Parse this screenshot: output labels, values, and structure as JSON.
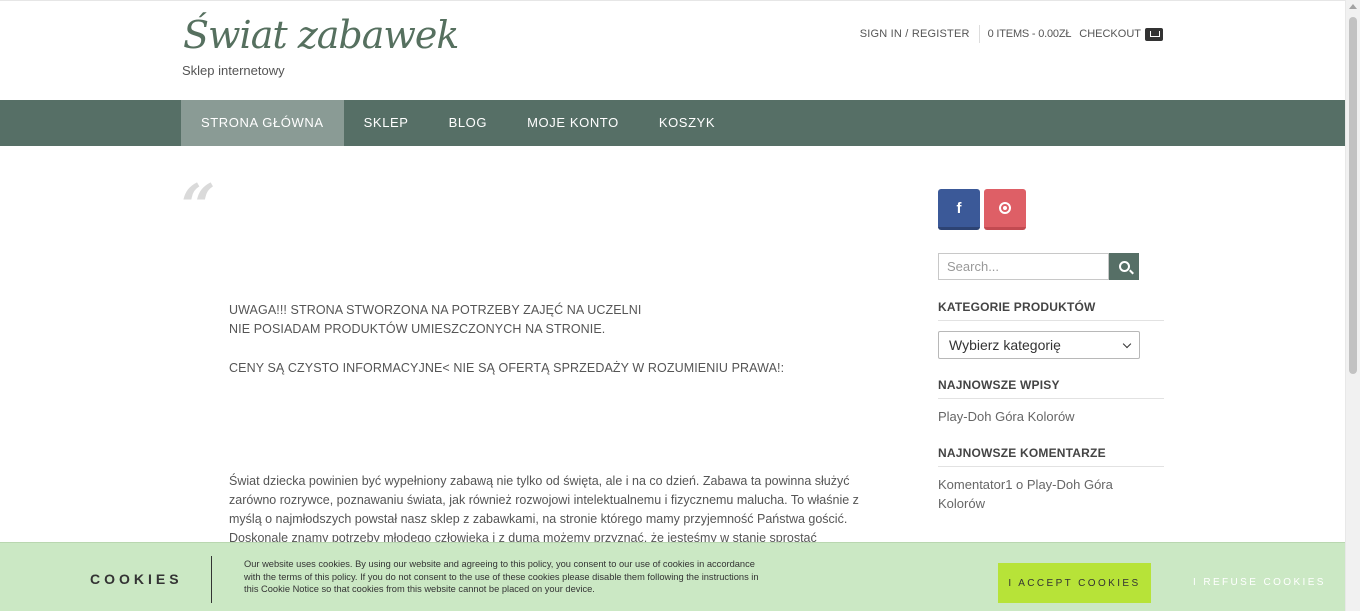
{
  "header": {
    "logo": "Świat zabawek",
    "tagline": "Sklep internetowy",
    "sign_in": "SIGN IN / REGISTER",
    "items": "0 ITEMS - 0.00ZŁ",
    "checkout": "CHECKOUT"
  },
  "nav": {
    "items": [
      {
        "label": "STRONA GŁÓWNA",
        "active": true
      },
      {
        "label": "SKLEP"
      },
      {
        "label": "BLOG"
      },
      {
        "label": "MOJE KONTO"
      },
      {
        "label": "KOSZYK"
      }
    ]
  },
  "main": {
    "quote_mark": "“",
    "notice_line1": "UWAGA!!!  STRONA STWORZONA NA POTRZEBY ZAJĘĆ NA UCZELNI",
    "notice_line2": "NIE POSIADAM PRODUKTÓW UMIESZCZONYCH NA STRONIE.",
    "notice_line3": "CENY SĄ CZYSTO INFORMACYJNE< NIE SĄ OFERTĄ SPRZEDAŻY W ROZUMIENIU PRAWA!:",
    "body": "Świat dziecka powinien być wypełniony zabawą nie tylko od święta, ale i na co dzień. Zabawa ta powinna służyć zarówno rozrywce, poznawaniu świata, jak również rozwojowi intelektualnemu i fizycznemu malucha. To właśnie z myślą o najmłodszych powstał nasz sklep z zabawkami, na stronie którego mamy przyjemność Państwa gościć. Doskonale znamy potrzeby młodego człowieka i z dumą możemy przyznać, że jesteśmy w stanie sprostać"
  },
  "sidebar": {
    "social": [
      {
        "icon": "facebook-icon",
        "glyph": "f",
        "color": "#3b5998"
      },
      {
        "icon": "pinterest-icon",
        "color": "#de5f66"
      }
    ],
    "search_placeholder": "Search...",
    "categories_title": "KATEGORIE PRODUKTÓW",
    "categories_select": "Wybierz kategorię",
    "recent_posts_title": "NAJNOWSZE WPISY",
    "recent_post": "Play-Doh Góra Kolorów",
    "recent_comments_title": "NAJNOWSZE KOMENTARZE",
    "recent_comment": "Komentator1 o Play-Doh Góra Kolorów"
  },
  "cookie": {
    "title": "COOKIES",
    "text": "Our website uses cookies. By using our website and agreeing to this policy, you consent to our use of cookies in accordance with the terms of this policy. If you do not consent to the use of these cookies please disable them following the instructions in this Cookie Notice so that cookies from this website cannot be placed on your device.",
    "accept": "I ACCEPT COOKIES",
    "refuse": "I REFUSE COOKIES"
  },
  "colors": {
    "nav_bg": "#566f66",
    "nav_active": "#8a9b95",
    "logo": "#56705f",
    "cookie_bg": "#cbe8c4",
    "accept_bg": "#b7e338"
  }
}
